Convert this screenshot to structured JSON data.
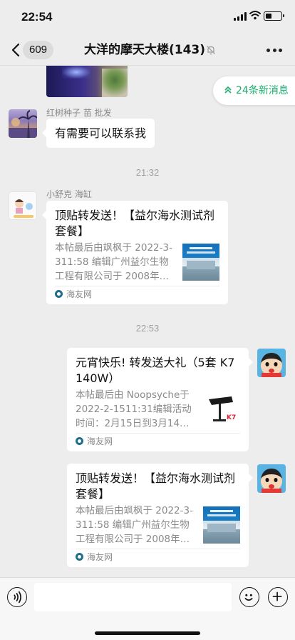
{
  "status": {
    "time": "22:54",
    "battery_level": 0.4
  },
  "nav": {
    "unread_badge": "609",
    "title": "大洋的摩天大楼(143)"
  },
  "new_messages": {
    "label": "24条新消息"
  },
  "messages": [
    {
      "sender": "红树种子 苗 批发",
      "text": "有需要可以联系我"
    },
    {
      "timestamp": "21:32"
    },
    {
      "sender": "小舒克 海缸",
      "card": {
        "title": "顶贴转发送！【益尔海水测试剂套餐】",
        "desc": "本帖最后由飒枫于 2022-3-311:58 编辑广州益尔生物工程有限公司于 2008年…",
        "source": "海友网"
      }
    },
    {
      "timestamp": "22:53"
    },
    {
      "card": {
        "title": "元宵快乐! 转发送大礼（5套 K7  140W）",
        "desc": "本帖最后由 Noopsyche于 2022-2-1511:31编辑活动时间：2月15日到3月14…",
        "source": "海友网"
      }
    },
    {
      "card": {
        "title": "顶贴转发送！【益尔海水测试剂套餐】",
        "desc": "本帖最后由飒枫于 2022-3-311:58 编辑广州益尔生物工程有限公司于 2008年…",
        "source": "海友网"
      }
    }
  ],
  "input": {
    "value": ""
  },
  "icons": {
    "back": "back-chevron-icon",
    "mute": "mute-bell-icon",
    "more": "more-dots-icon",
    "voice": "voice-icon",
    "emoji": "emoji-icon",
    "plus": "plus-icon"
  },
  "colors": {
    "background": "#ededed",
    "accent": "#1aad6b",
    "bubble": "#ffffff"
  }
}
